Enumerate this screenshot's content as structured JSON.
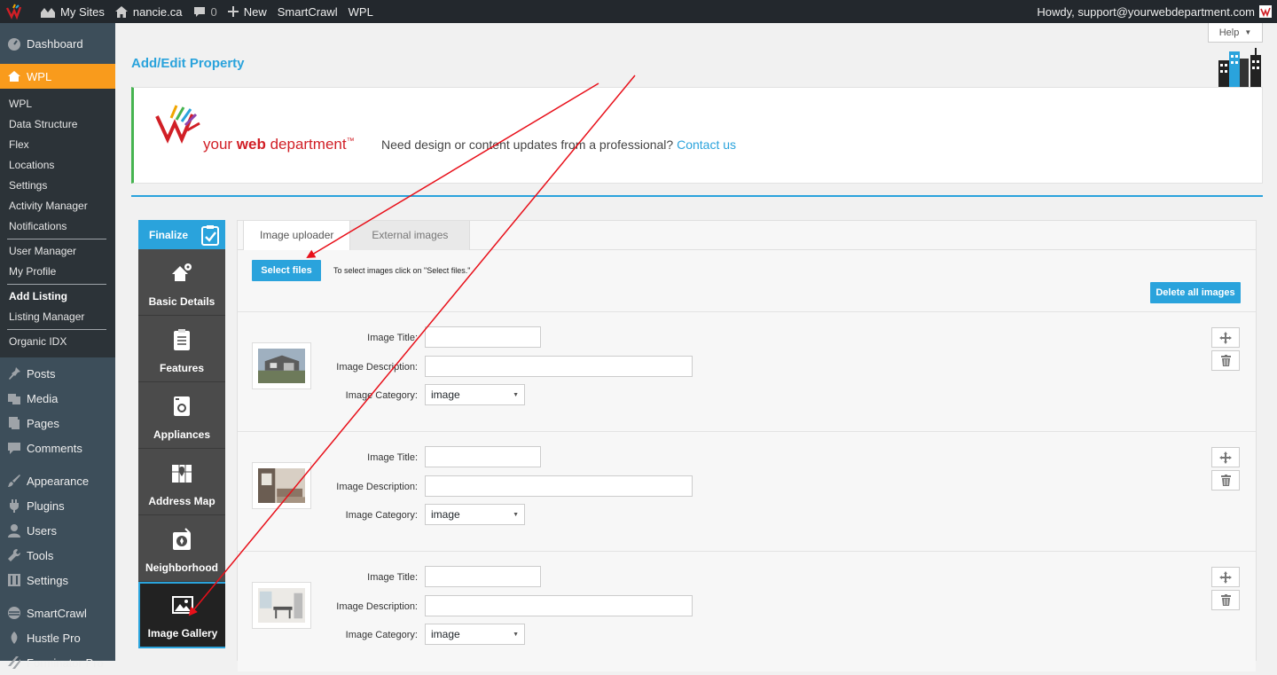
{
  "adminbar": {
    "my_sites": "My Sites",
    "site": "nancie.ca",
    "comments_count": "0",
    "new": "New",
    "smartcrawl": "SmartCrawl",
    "wpl": "WPL",
    "howdy": "Howdy, support@yourwebdepartment.com"
  },
  "sidebar": {
    "dashboard": "Dashboard",
    "wpl": "WPL",
    "sub_group1": [
      "WPL",
      "Data Structure",
      "Flex",
      "Locations",
      "Settings",
      "Activity Manager",
      "Notifications"
    ],
    "sub_group2": [
      "User Manager",
      "My Profile"
    ],
    "sub_group3": [
      "Add Listing",
      "Listing Manager"
    ],
    "sub_group4": [
      "Organic IDX"
    ],
    "menu": [
      {
        "label": "Posts",
        "icon": "pin-icon"
      },
      {
        "label": "Media",
        "icon": "media-icon"
      },
      {
        "label": "Pages",
        "icon": "pages-icon"
      },
      {
        "label": "Comments",
        "icon": "comments-icon"
      }
    ],
    "menu2": [
      {
        "label": "Appearance",
        "icon": "brush-icon"
      },
      {
        "label": "Plugins",
        "icon": "plugin-icon"
      },
      {
        "label": "Users",
        "icon": "user-icon"
      },
      {
        "label": "Tools",
        "icon": "wrench-icon"
      },
      {
        "label": "Settings",
        "icon": "settings-icon"
      }
    ],
    "menu3": [
      {
        "label": "SmartCrawl",
        "icon": "smartcrawl-icon"
      },
      {
        "label": "Hustle Pro",
        "icon": "hustle-icon"
      },
      {
        "label": "Forminator Pro",
        "icon": "forminator-icon"
      }
    ]
  },
  "header": {
    "title": "Add/Edit Property",
    "help": "Help"
  },
  "banner": {
    "logo_pre": "your ",
    "logo_bold": "web",
    "logo_post": " department",
    "logo_tm": "™",
    "message": "Need design or content updates from a professional?",
    "link": "Contact us"
  },
  "vtabs": {
    "finalize": "Finalize",
    "items": [
      "Basic Details",
      "Features",
      "Appliances",
      "Address Map",
      "Neighborhood",
      "Image Gallery"
    ]
  },
  "panel": {
    "tabs": [
      "Image uploader",
      "External images"
    ],
    "select_files": "Select files",
    "hint": "To select images click on \"Select files.\"",
    "delete_all": "Delete all images"
  },
  "image_rows": [
    {
      "title_label": "Image Title:",
      "desc_label": "Image Description:",
      "cat_label": "Image Category:",
      "category": "image",
      "title": "",
      "description": ""
    },
    {
      "title_label": "Image Title:",
      "desc_label": "Image Description:",
      "cat_label": "Image Category:",
      "category": "image",
      "title": "",
      "description": ""
    },
    {
      "title_label": "Image Title:",
      "desc_label": "Image Description:",
      "cat_label": "Image Category:",
      "category": "image",
      "title": "",
      "description": ""
    }
  ],
  "colors": {
    "accent_blue": "#2aa3dc",
    "wpl_orange": "#f99b1c",
    "sidebar_bg": "#3d4e5a",
    "annotation_red": "#e8101a"
  }
}
